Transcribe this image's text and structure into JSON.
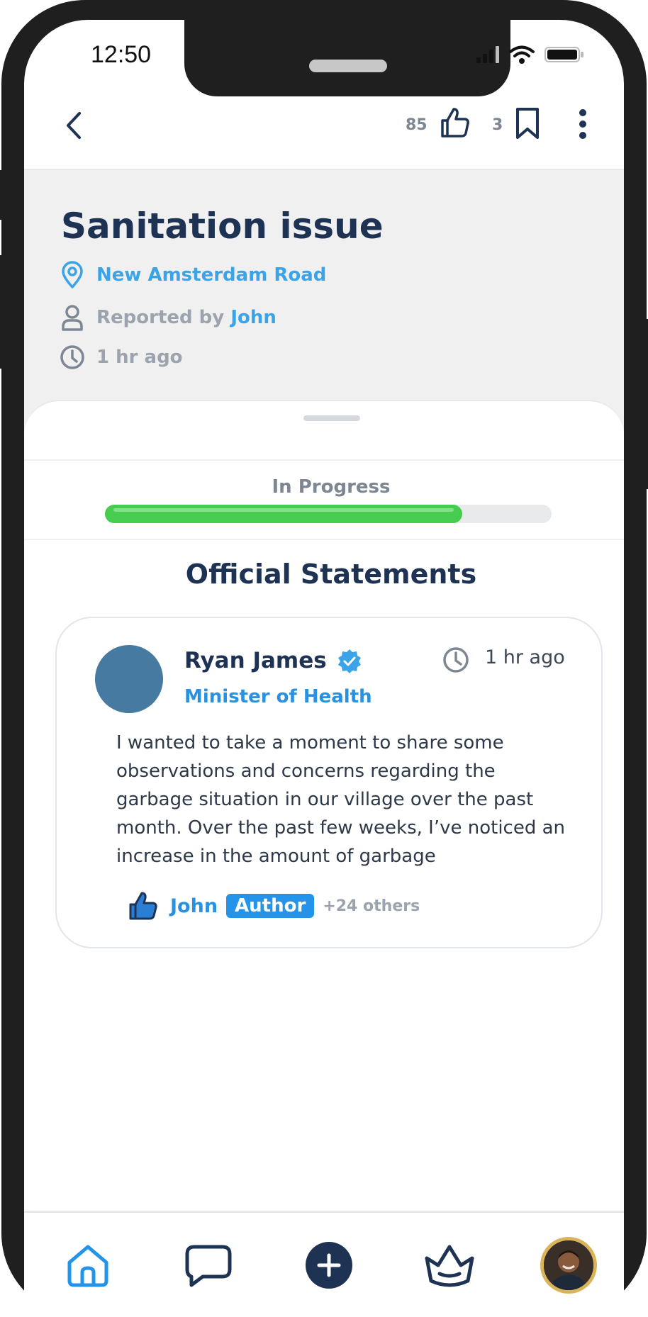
{
  "status_bar": {
    "time": "12:50"
  },
  "topbar": {
    "likes_count": "85",
    "saves_count": "3"
  },
  "issue": {
    "title": "Sanitation issue",
    "location": "New Amsterdam Road",
    "reported_by_label": "Reported by",
    "reporter": "John",
    "time_ago": "1 hr ago"
  },
  "progress": {
    "status_label": "In Progress",
    "value_fraction": 0.8
  },
  "statements": {
    "section_title": "Official Statements",
    "items": [
      {
        "author": "Ryan James",
        "role": "Minister of Health",
        "time": "1 hr ago",
        "body": " I wanted to take a moment to share some observations and concerns regarding the garbage situation in our village over the past month. Over the past few weeks, I’ve noticed an increase in the amount of garbage",
        "liked_by": "John",
        "liked_by_badge": "Author",
        "others": "+24 others"
      }
    ]
  },
  "colors": {
    "primary_dark": "#1e3354",
    "accent_blue": "#3ba4e8",
    "progress_green": "#46cc4f",
    "avatar_blue": "#467aa0"
  },
  "icons": {
    "top": [
      "back-chevron-icon",
      "thumbs-up-icon",
      "bookmark-icon",
      "more-vertical-icon"
    ],
    "nav": [
      "home-icon",
      "chat-bubble-icon",
      "plus-circle-icon",
      "crown-icon",
      "profile-avatar"
    ]
  }
}
